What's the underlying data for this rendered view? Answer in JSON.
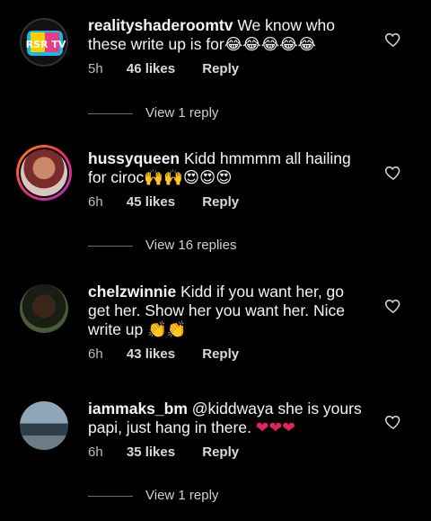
{
  "comments": [
    {
      "username": "realityshaderoomtv",
      "text": " We know who these write up is for",
      "emojis": "😂😂😂😂😂",
      "time": "5h",
      "likes": "46 likes",
      "reply": "Reply",
      "view_replies": "View 1 reply",
      "avatar_text": "RSR TV"
    },
    {
      "username": "hussyqueen",
      "text": " Kidd hmmmm all hailing for ciroc",
      "emojis": "🙌🙌😍😍😍",
      "time": "6h",
      "likes": "45 likes",
      "reply": "Reply",
      "view_replies": "View 16 replies"
    },
    {
      "username": "chelzwinnie",
      "text": " Kidd if you want her, go get her. Show her you want her. Nice write up ",
      "emojis": "👏👏",
      "time": "6h",
      "likes": "43 likes",
      "reply": "Reply"
    },
    {
      "username": "iammaks_bm",
      "text": " @kiddwaya she is yours papi, just hang in there. ",
      "emojis": "❤❤❤",
      "time": "6h",
      "likes": "35 likes",
      "reply": "Reply",
      "view_replies": "View 1 reply"
    }
  ],
  "icons": {
    "like": "heart-outline-icon"
  },
  "colors": {
    "background": "#000000",
    "text": "#f5f5f5",
    "heart_emoji": "#e0245e"
  }
}
